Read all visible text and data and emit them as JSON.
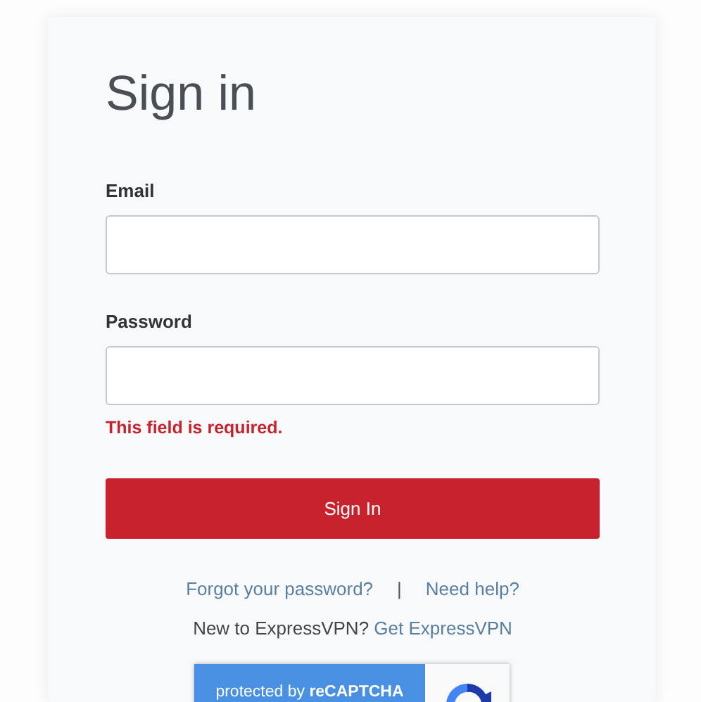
{
  "title": "Sign in",
  "fields": [
    {
      "label": "Email"
    },
    {
      "label": "Password",
      "error": "This field is required."
    }
  ],
  "submit": "Sign In",
  "links": [
    "Forgot your password?",
    "Need help?"
  ],
  "separator": "|",
  "signup": {
    "text": "New to ExpressVPN?",
    "link": "Get ExpressVPN"
  },
  "captcha": {
    "text": "protected by **reCAPTCHA**"
  }
}
